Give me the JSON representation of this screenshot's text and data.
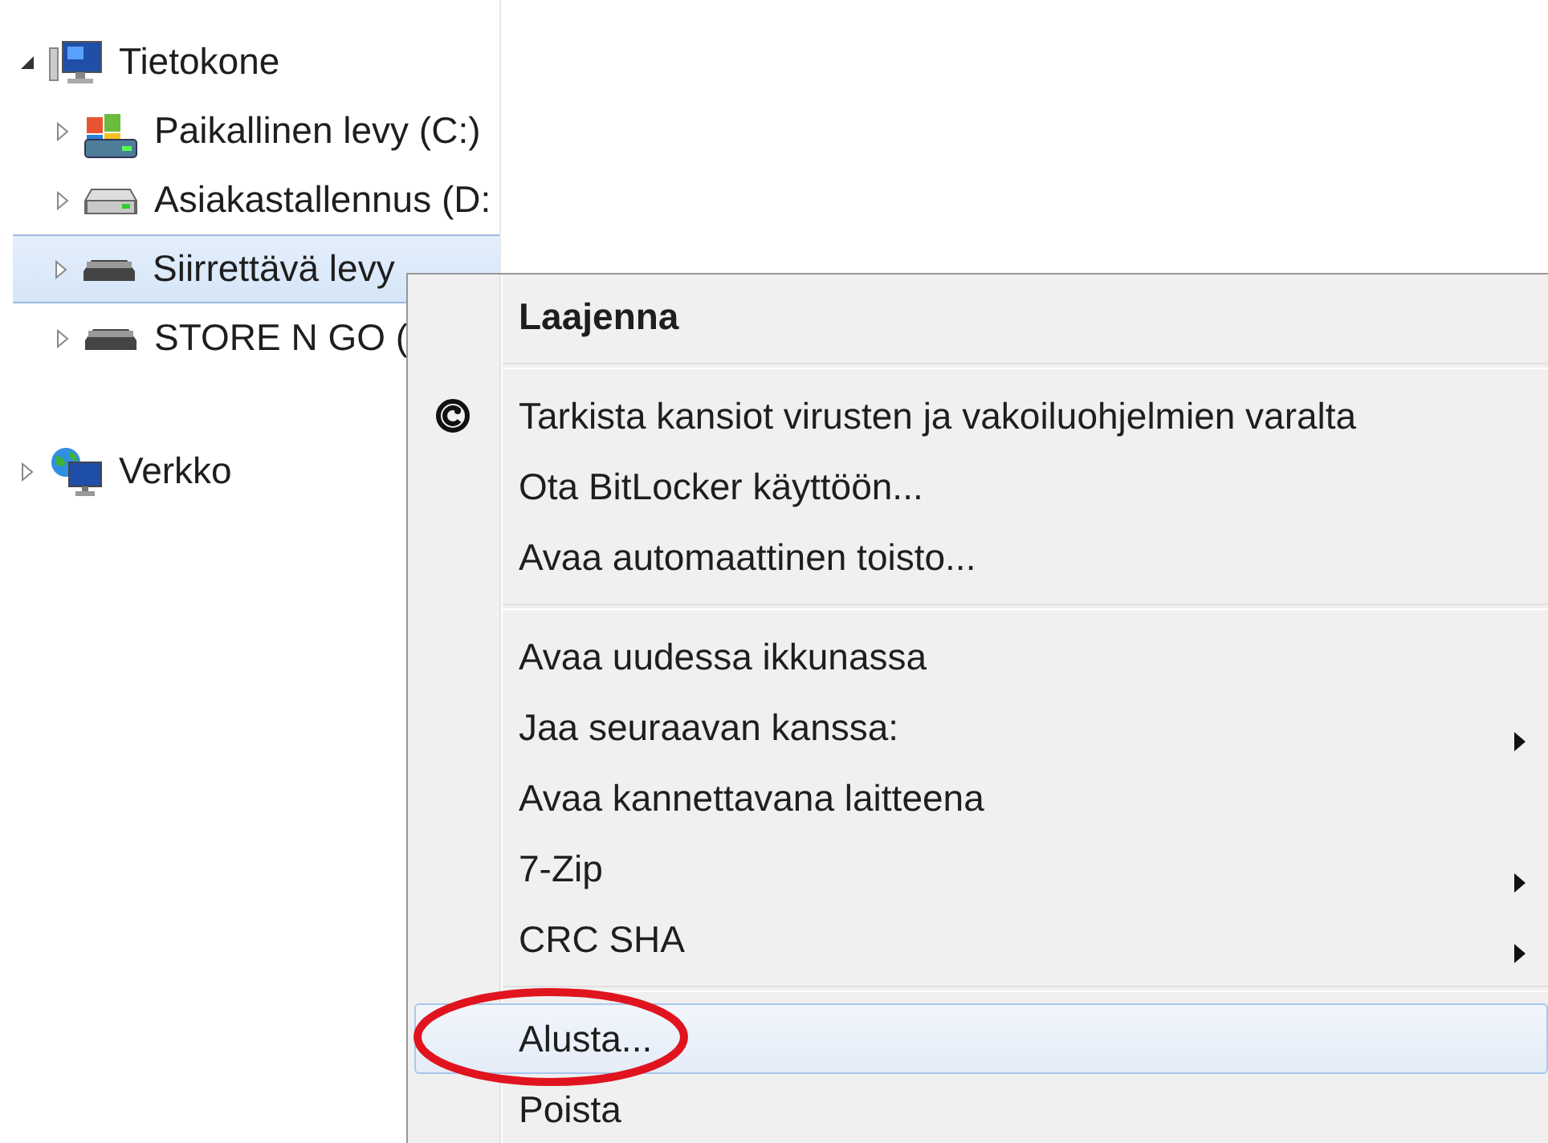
{
  "tree": [
    {
      "label": "Tietokone",
      "kind": "computer",
      "expanded": true,
      "selected": false,
      "children": [
        {
          "label": "Paikallinen levy (C:)",
          "kind": "system-drive",
          "expanded": false,
          "selected": false
        },
        {
          "label": "Asiakastallennus (D:",
          "kind": "drive",
          "expanded": false,
          "selected": false
        },
        {
          "label": "Siirrettävä levy",
          "kind": "removable",
          "expanded": false,
          "selected": true
        },
        {
          "label": "STORE N GO (",
          "kind": "removable",
          "expanded": false,
          "selected": false
        }
      ]
    },
    {
      "label": "Verkko",
      "kind": "network",
      "expanded": false,
      "selected": false
    }
  ],
  "context_menu": {
    "items": [
      {
        "kind": "item",
        "label": "Laajenna",
        "default": true,
        "has_icon": false,
        "submenu": false,
        "highlighted": false,
        "circled": false
      },
      {
        "kind": "separator"
      },
      {
        "kind": "item",
        "label": "Tarkista kansiot virusten ja vakoiluohjelmien varalta",
        "default": false,
        "has_icon": true,
        "submenu": false,
        "highlighted": false,
        "circled": false
      },
      {
        "kind": "item",
        "label": "Ota BitLocker käyttöön...",
        "default": false,
        "has_icon": false,
        "submenu": false,
        "highlighted": false,
        "circled": false
      },
      {
        "kind": "item",
        "label": "Avaa automaattinen toisto...",
        "default": false,
        "has_icon": false,
        "submenu": false,
        "highlighted": false,
        "circled": false
      },
      {
        "kind": "separator"
      },
      {
        "kind": "item",
        "label": "Avaa uudessa ikkunassa",
        "default": false,
        "has_icon": false,
        "submenu": false,
        "highlighted": false,
        "circled": false
      },
      {
        "kind": "item",
        "label": "Jaa seuraavan kanssa:",
        "default": false,
        "has_icon": false,
        "submenu": true,
        "highlighted": false,
        "circled": false
      },
      {
        "kind": "item",
        "label": "Avaa kannettavana laitteena",
        "default": false,
        "has_icon": false,
        "submenu": false,
        "highlighted": false,
        "circled": false
      },
      {
        "kind": "item",
        "label": "7-Zip",
        "default": false,
        "has_icon": false,
        "submenu": true,
        "highlighted": false,
        "circled": false
      },
      {
        "kind": "item",
        "label": "CRC SHA",
        "default": false,
        "has_icon": false,
        "submenu": true,
        "highlighted": false,
        "circled": false
      },
      {
        "kind": "separator"
      },
      {
        "kind": "item",
        "label": "Alusta...",
        "default": false,
        "has_icon": false,
        "submenu": false,
        "highlighted": true,
        "circled": true
      },
      {
        "kind": "item",
        "label": "Poista",
        "default": false,
        "has_icon": false,
        "submenu": false,
        "highlighted": false,
        "circled": false
      }
    ]
  }
}
